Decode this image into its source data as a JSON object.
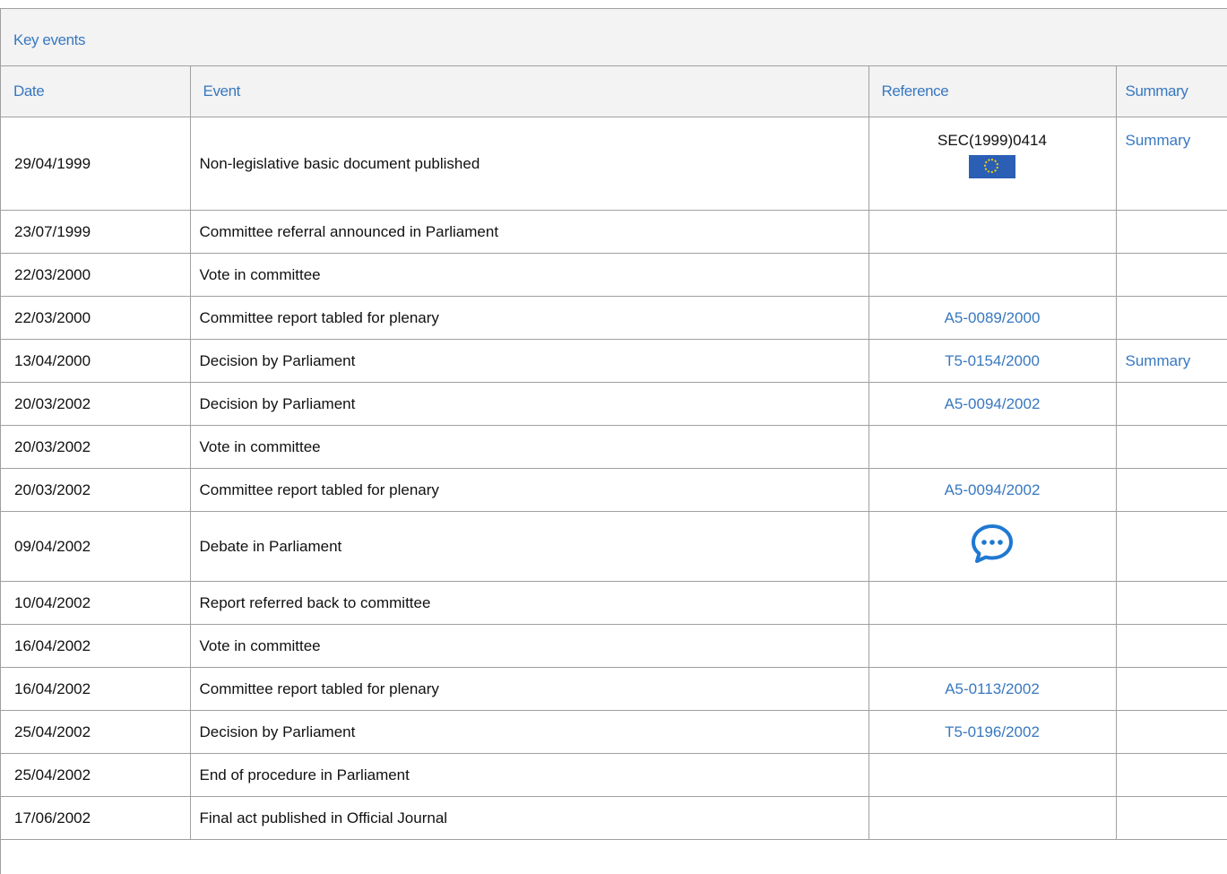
{
  "panel": {
    "title": "Key events"
  },
  "table": {
    "headers": {
      "date": "Date",
      "event": "Event",
      "reference": "Reference",
      "summary": "Summary"
    },
    "rows": [
      {
        "date": "29/04/1999",
        "event": "Non-legislative basic document published",
        "reference": "SEC(1999)0414",
        "reference_icon": "eu-flag-icon",
        "summary": "Summary"
      },
      {
        "date": "23/07/1999",
        "event": "Committee referral announced in Parliament",
        "reference": "",
        "summary": ""
      },
      {
        "date": "22/03/2000",
        "event": "Vote in committee",
        "reference": "",
        "summary": ""
      },
      {
        "date": "22/03/2000",
        "event": "Committee report tabled for plenary",
        "reference": "A5-0089/2000",
        "summary": ""
      },
      {
        "date": "13/04/2000",
        "event": "Decision by Parliament",
        "reference": "T5-0154/2000",
        "summary": "Summary"
      },
      {
        "date": "20/03/2002",
        "event": "Decision by Parliament",
        "reference": "A5-0094/2002",
        "summary": ""
      },
      {
        "date": "20/03/2002",
        "event": "Vote in committee",
        "reference": "",
        "summary": ""
      },
      {
        "date": "20/03/2002",
        "event": "Committee report tabled for plenary",
        "reference": "A5-0094/2002",
        "summary": ""
      },
      {
        "date": "09/04/2002",
        "event": "Debate in Parliament",
        "reference": "",
        "reference_icon": "debate-speech-bubble-icon",
        "summary": ""
      },
      {
        "date": "10/04/2002",
        "event": "Report referred back to committee",
        "reference": "",
        "summary": ""
      },
      {
        "date": "16/04/2002",
        "event": "Vote in committee",
        "reference": "",
        "summary": ""
      },
      {
        "date": "16/04/2002",
        "event": "Committee report tabled for plenary",
        "reference": "A5-0113/2002",
        "summary": ""
      },
      {
        "date": "25/04/2002",
        "event": "Decision by Parliament",
        "reference": "T5-0196/2002",
        "summary": ""
      },
      {
        "date": "25/04/2002",
        "event": "End of procedure in Parliament",
        "reference": "",
        "summary": ""
      },
      {
        "date": "17/06/2002",
        "event": "Final act published in Official Journal",
        "reference": "",
        "summary": ""
      }
    ]
  },
  "colors": {
    "link": "#3878c0",
    "header_bg": "#f3f3f3",
    "border": "#a0a0a0",
    "eu_flag_blue": "#2b5fb5",
    "eu_flag_stars": "#f5d000"
  }
}
